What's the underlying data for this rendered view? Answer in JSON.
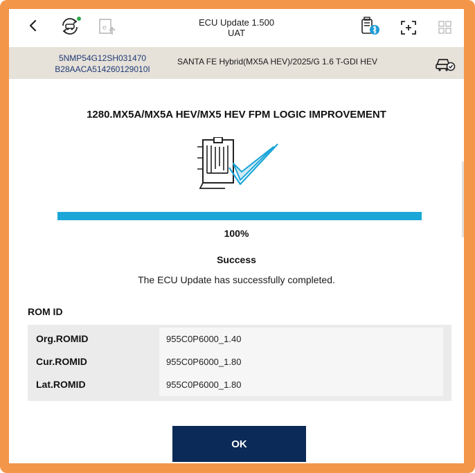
{
  "header": {
    "title": "ECU Update 1.500",
    "subtitle": "UAT",
    "back_icon": "chevron-left-icon",
    "icons": [
      "car-sync-icon",
      "e-update-icon",
      "vci-bluetooth-icon",
      "expand-icon",
      "grid-icon"
    ]
  },
  "vehicle": {
    "vin": "5NMP54G12SH031470",
    "code": "B28AACA514260129010I",
    "model": "SANTA FE Hybrid(MX5A HEV)/2025/G 1.6 T-GDI HEV",
    "icon": "vehicle-check-icon"
  },
  "update": {
    "title": "1280.MX5A/MX5A HEV/MX5 HEV FPM LOGIC IMPROVEMENT",
    "progress_fraction": 1.0,
    "progress_text": "100%",
    "status": "Success",
    "message": "The ECU Update has successfully completed."
  },
  "romid": {
    "label": "ROM ID",
    "rows": [
      {
        "key": "Org.ROMID",
        "value": "955C0P6000_1.40"
      },
      {
        "key": "Cur.ROMID",
        "value": "955C0P6000_1.80"
      },
      {
        "key": "Lat.ROMID",
        "value": "955C0P6000_1.80"
      }
    ]
  },
  "ok_label": "OK",
  "colors": {
    "frame": "#f4964a",
    "accent": "#1ba6d8",
    "button": "#0b2a57",
    "vin_text": "#1e3a75"
  }
}
